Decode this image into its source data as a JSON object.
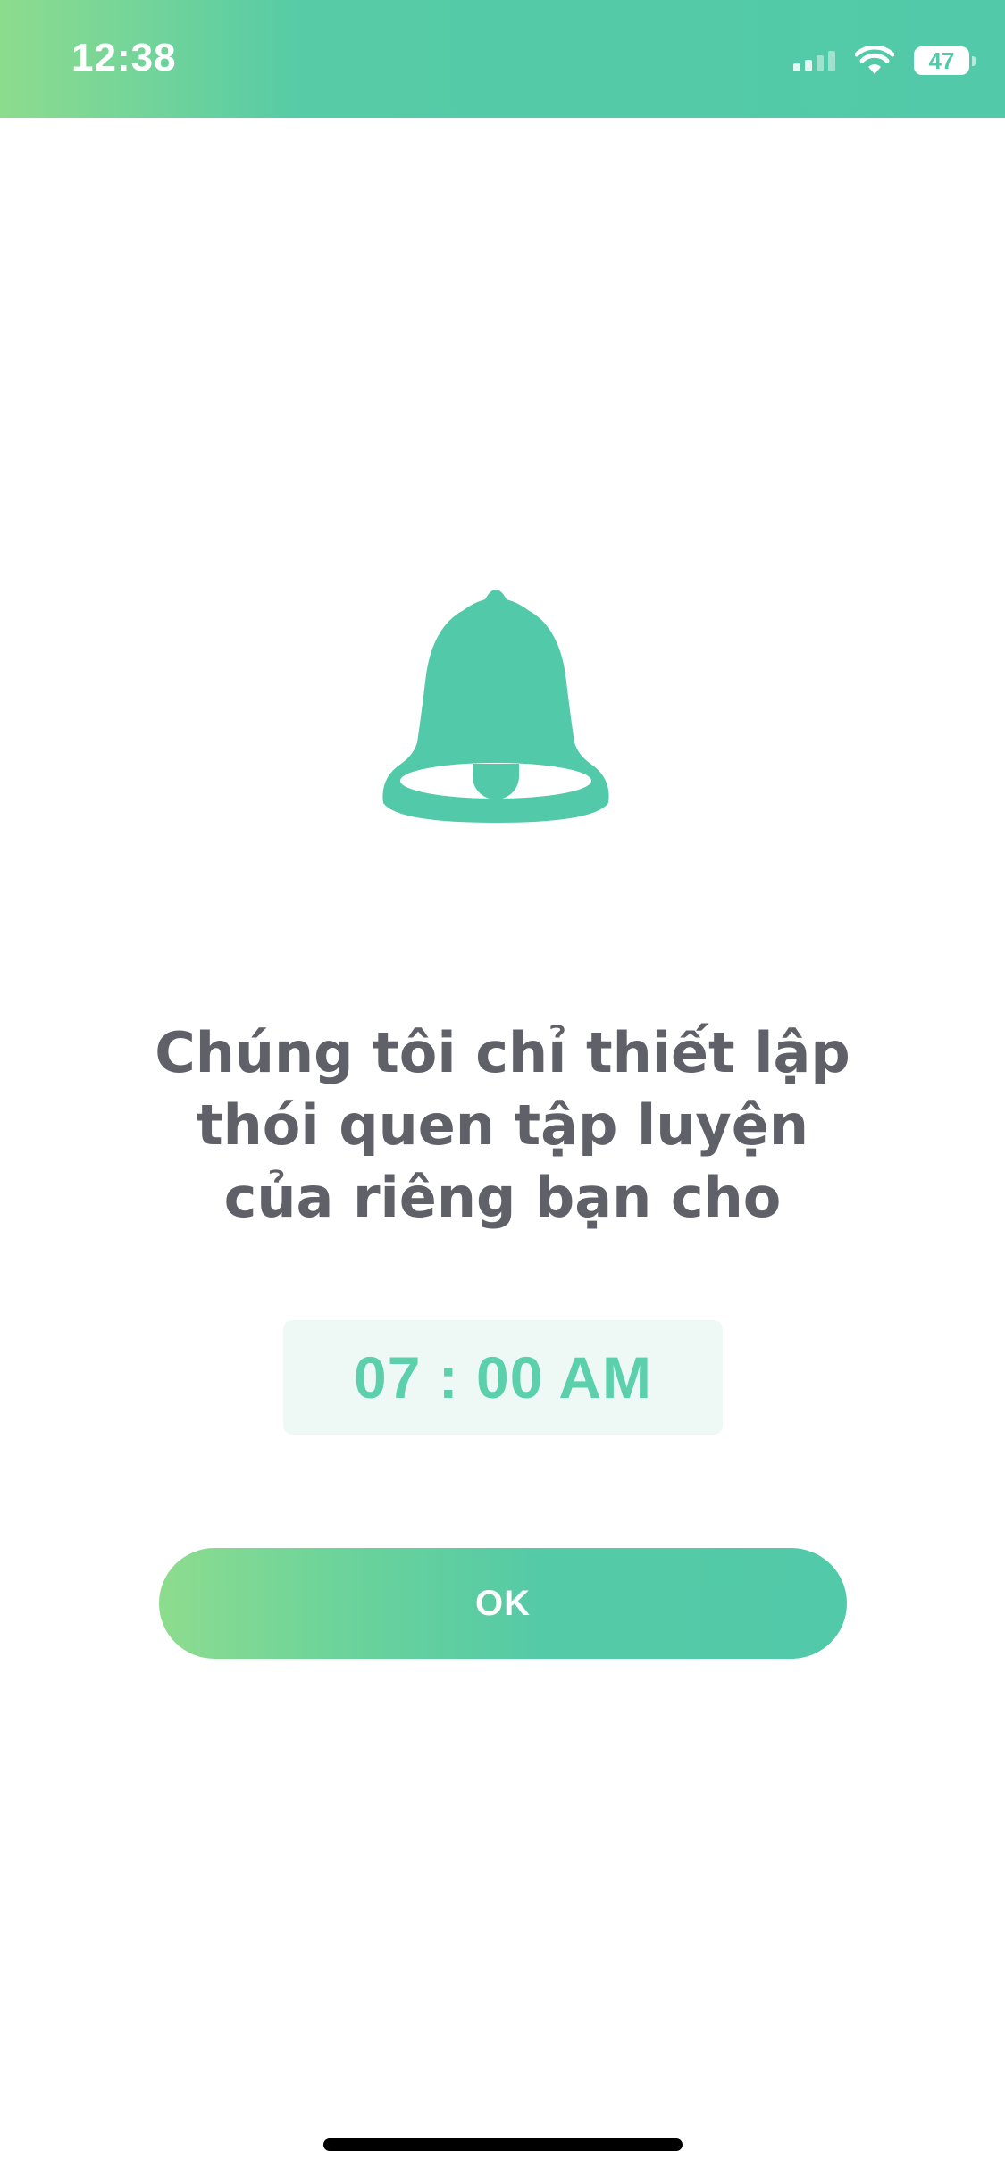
{
  "status_bar": {
    "time": "12:38",
    "battery_level": "47",
    "icons": [
      "cellular-signal-icon",
      "wifi-icon",
      "battery-icon"
    ],
    "background_colors": [
      "#8ddc8e",
      "#52c9a8"
    ]
  },
  "main": {
    "icon": "bell-icon",
    "icon_color": "#52c9a8",
    "headline_lines": [
      "Chúng tôi chỉ thiết lập",
      "thói quen tập luyện",
      "của riêng bạn cho"
    ],
    "time_value": "07 : 00 AM",
    "ok_label": "OK"
  },
  "colors": {
    "accent": "#52c9a8",
    "accent_light": "#8ddc8e",
    "text": "#5f6068",
    "time_text": "#5ccfab",
    "time_box_bg": "#eef9f5"
  }
}
